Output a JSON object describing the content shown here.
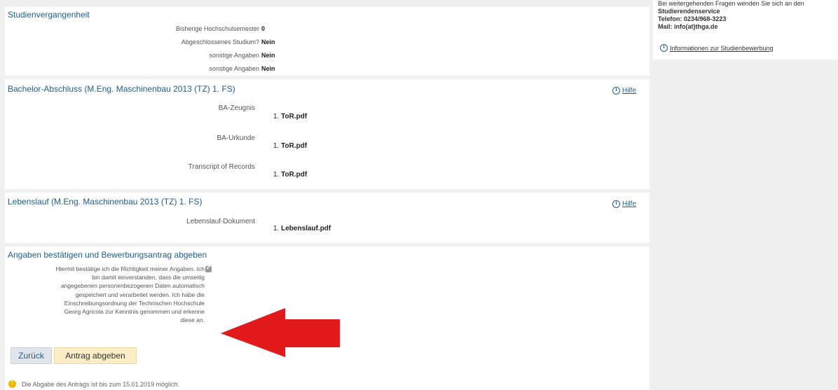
{
  "study_history": {
    "title": "Studienvergangenheit",
    "rows": [
      {
        "label": "Bisherige Hochschulsemester",
        "value": "0"
      },
      {
        "label": "Abgeschlossenes Studium?",
        "value": "Nein"
      },
      {
        "label": "sonstige Angaben",
        "value": "Nein"
      },
      {
        "label": "sonstige Angaben",
        "value": "Nein"
      }
    ]
  },
  "bachelor": {
    "title": "Bachelor-Abschluss (M.Eng. Maschinenbau 2013 (TZ) 1. FS)",
    "help": "Hilfe",
    "docs": [
      {
        "label": "BA-Zeugnis",
        "num": "1.",
        "file": "ToR.pdf"
      },
      {
        "label": "BA-Urkunde",
        "num": "1.",
        "file": "ToR.pdf"
      },
      {
        "label": "Transcript of Records",
        "num": "1.",
        "file": "ToR.pdf"
      }
    ]
  },
  "cv": {
    "title": "Lebenslauf (M.Eng. Maschinenbau 2013 (TZ) 1. FS)",
    "help": "Hilfe",
    "doc": {
      "label": "Lebenslauf-Dokument",
      "num": "1.",
      "file": "Lebenslauf.pdf"
    }
  },
  "confirm": {
    "title": "Angaben bestätigen und Bewerbungsantrag abgeben",
    "lines": [
      "Hiermit bestätige ich die Richtigkeit meiner Angaben. Ich",
      "bin damit einverstanden, dass die umseitig",
      "angegebenen personenbezogenen Daten automatisch",
      "gespeichert und verarbeitet werden. Ich habe die",
      "Einschreibungsordnung der Technischen Hochschule",
      "Georg Agricola zur Kenntnis genommen und erkenne",
      "diese an."
    ],
    "checked": true,
    "back_label": "Zurück",
    "submit_label": "Antrag abgeben",
    "notice": "Die Abgabe des Antrags ist bis zum 15.01.2019 möglich."
  },
  "sidebar": {
    "intro": "Bei weitergehenden Fragen wenden Sie sich an den",
    "service": "Studierendenservice",
    "phone": "Telefon: 0234/968-3223",
    "mail": "Mail: info(at)thga.de",
    "info_link": "Informationen zur Studienbewerbung"
  },
  "colors": {
    "title_blue": "#1f5f8b",
    "arrow_red": "#e3191b",
    "submit_bg": "#fbeec7"
  }
}
